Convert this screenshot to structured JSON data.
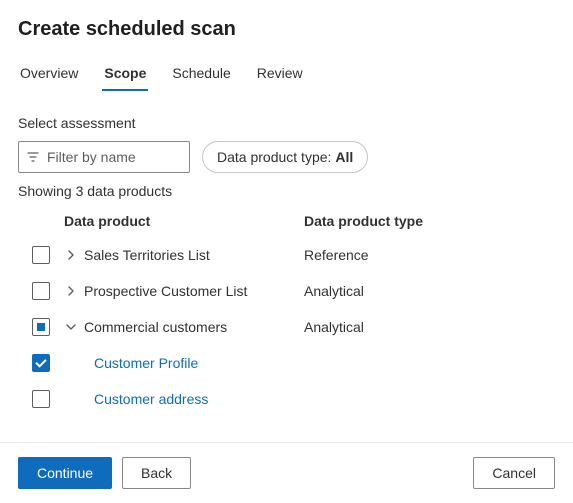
{
  "title": "Create scheduled scan",
  "tabs": {
    "overview": "Overview",
    "scope": "Scope",
    "schedule": "Schedule",
    "review": "Review",
    "active": "scope"
  },
  "section_label": "Select assessment",
  "filter": {
    "placeholder": "Filter by name",
    "value": ""
  },
  "type_pill_prefix": "Data product type:",
  "type_pill_value": "All",
  "count_line": "Showing 3 data products",
  "columns": {
    "product": "Data product",
    "type": "Data product type"
  },
  "rows": [
    {
      "label": "Sales Territories List",
      "type": "Reference",
      "checked": false,
      "indeterminate": false,
      "expandable": true,
      "expanded": false,
      "link": false,
      "indent": 0
    },
    {
      "label": "Prospective Customer List",
      "type": "Analytical",
      "checked": false,
      "indeterminate": false,
      "expandable": true,
      "expanded": false,
      "link": false,
      "indent": 0
    },
    {
      "label": "Commercial customers",
      "type": "Analytical",
      "checked": false,
      "indeterminate": true,
      "expandable": true,
      "expanded": true,
      "link": false,
      "indent": 0
    },
    {
      "label": "Customer Profile",
      "type": "",
      "checked": true,
      "indeterminate": false,
      "expandable": false,
      "expanded": false,
      "link": true,
      "indent": 1
    },
    {
      "label": "Customer address",
      "type": "",
      "checked": false,
      "indeterminate": false,
      "expandable": false,
      "expanded": false,
      "link": true,
      "indent": 1
    }
  ],
  "footer": {
    "continue": "Continue",
    "back": "Back",
    "cancel": "Cancel"
  }
}
